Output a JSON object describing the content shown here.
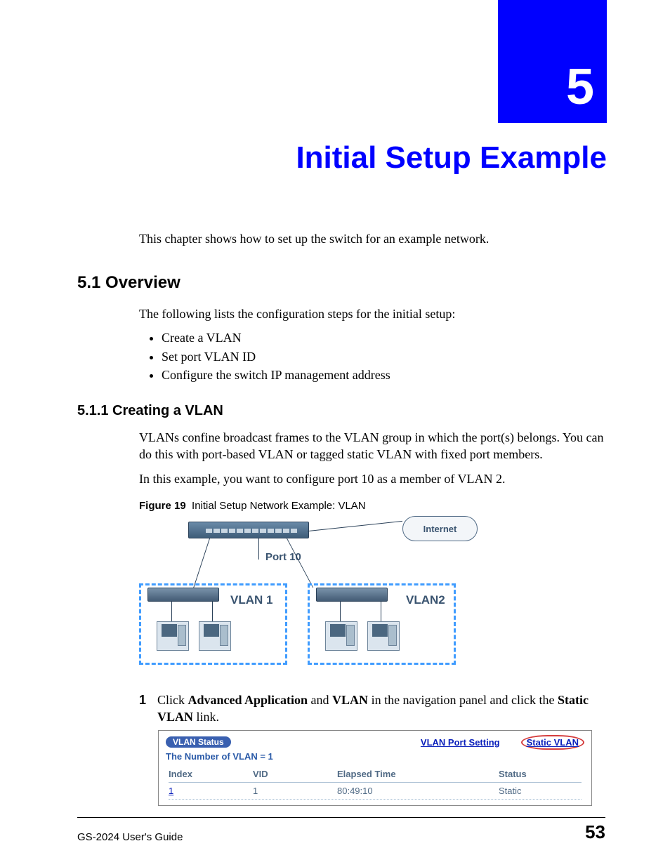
{
  "chapter": {
    "number": "5",
    "title": "Initial Setup Example"
  },
  "intro": "This chapter shows how to set up the switch for an example network.",
  "section_overview": {
    "heading": "5.1  Overview",
    "lead": "The following lists the configuration steps for the initial setup:",
    "bullets": [
      "Create a VLAN",
      "Set port VLAN ID",
      "Configure the switch IP management address"
    ]
  },
  "subsection_create_vlan": {
    "heading": "5.1.1  Creating a VLAN",
    "para1": "VLANs confine broadcast frames to the VLAN group in which the port(s) belongs. You can do this with port-based VLAN or tagged static VLAN with fixed port members.",
    "para2": "In this example, you want to configure port 10 as a member of VLAN 2."
  },
  "figure": {
    "label": "Figure 19",
    "caption": "Initial Setup Network Example: VLAN",
    "internet": "Internet",
    "port_label": "Port 10",
    "vlan1": "VLAN 1",
    "vlan2": "VLAN2"
  },
  "step1": {
    "num": "1",
    "pre": "Click ",
    "b1": "Advanced Application",
    "mid1": " and ",
    "b2": "VLAN",
    "mid2": " in the navigation panel and click the ",
    "b3": "Static VLAN",
    "post": " link."
  },
  "vlan_panel": {
    "title_tab": "VLAN Status",
    "link_port_setting": "VLAN Port Setting",
    "link_static": "Static VLAN",
    "subtitle": "The Number of VLAN = 1",
    "headers": {
      "c1": "Index",
      "c2": "VID",
      "c3": "Elapsed Time",
      "c4": "Status"
    },
    "row": {
      "index": "1",
      "vid": "1",
      "elapsed": "80:49:10",
      "status": "Static"
    }
  },
  "footer": {
    "guide": "GS-2024 User's Guide",
    "page": "53"
  }
}
